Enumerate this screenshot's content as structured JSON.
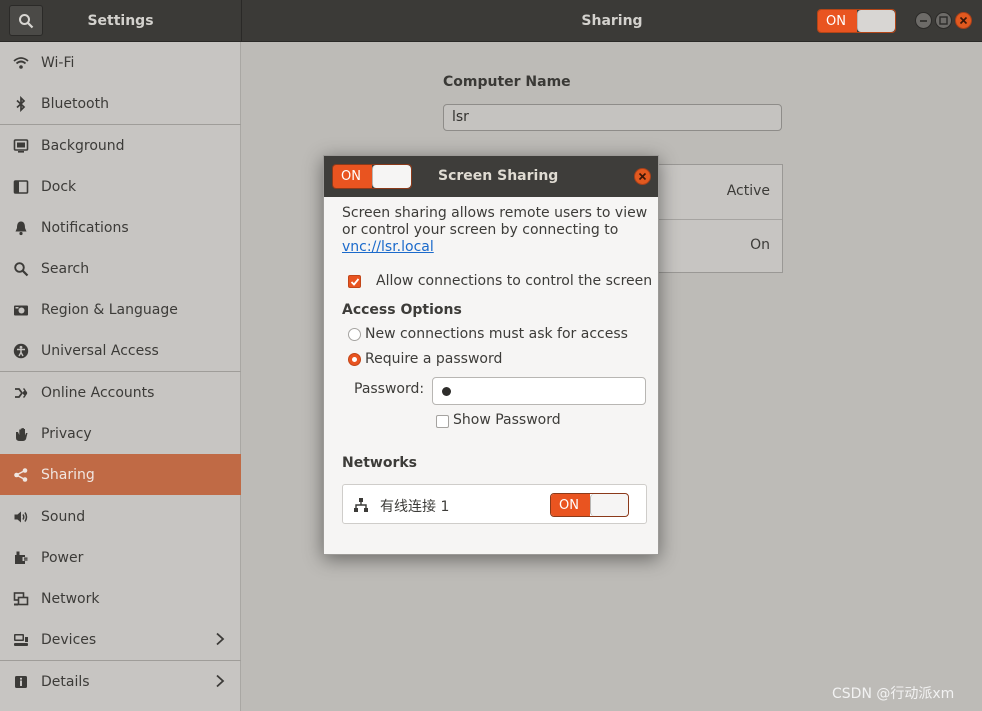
{
  "header": {
    "left_title": "Settings",
    "main_title": "Sharing",
    "switch_label": "ON"
  },
  "sidebar": {
    "items": [
      {
        "label": "Wi-Fi",
        "icon": "wifi-icon"
      },
      {
        "label": "Bluetooth",
        "icon": "bluetooth-icon"
      },
      {
        "label": "Background",
        "icon": "background-icon"
      },
      {
        "label": "Dock",
        "icon": "dock-icon"
      },
      {
        "label": "Notifications",
        "icon": "bell-icon"
      },
      {
        "label": "Search",
        "icon": "search-icon"
      },
      {
        "label": "Region & Language",
        "icon": "camera-icon"
      },
      {
        "label": "Universal Access",
        "icon": "accessibility-icon"
      },
      {
        "label": "Online Accounts",
        "icon": "online-accounts-icon"
      },
      {
        "label": "Privacy",
        "icon": "hand-icon"
      },
      {
        "label": "Sharing",
        "icon": "share-icon"
      },
      {
        "label": "Sound",
        "icon": "speaker-icon"
      },
      {
        "label": "Power",
        "icon": "power-icon"
      },
      {
        "label": "Network",
        "icon": "network-icon"
      },
      {
        "label": "Devices",
        "icon": "devices-icon"
      },
      {
        "label": "Details",
        "icon": "info-icon"
      }
    ],
    "active": "Sharing"
  },
  "main": {
    "computer_name_label": "Computer Name",
    "computer_name_value": "lsr",
    "services": [
      {
        "status": "Active"
      },
      {
        "status": "On"
      }
    ]
  },
  "dialog": {
    "switch_label": "ON",
    "title": "Screen Sharing",
    "description_prefix": "Screen sharing allows remote users to view or control your screen by connecting to ",
    "description_link": "vnc://lsr.local",
    "allow_control_label": "Allow connections to control the screen",
    "allow_control_checked": true,
    "access_options_heading": "Access Options",
    "option_ask": "New connections must ask for access",
    "option_password": "Require a password",
    "selected_option": "Require a password",
    "password_label": "Password:",
    "show_password_label": "Show Password",
    "show_password_checked": false,
    "networks_heading": "Networks",
    "network_name": "有线连接 1",
    "network_switch_label": "ON"
  },
  "watermark": "CSDN @行动派xm",
  "colors": {
    "accent": "#e95420",
    "header_bg": "#3b3a37",
    "sidebar_active": "#c06a45"
  }
}
